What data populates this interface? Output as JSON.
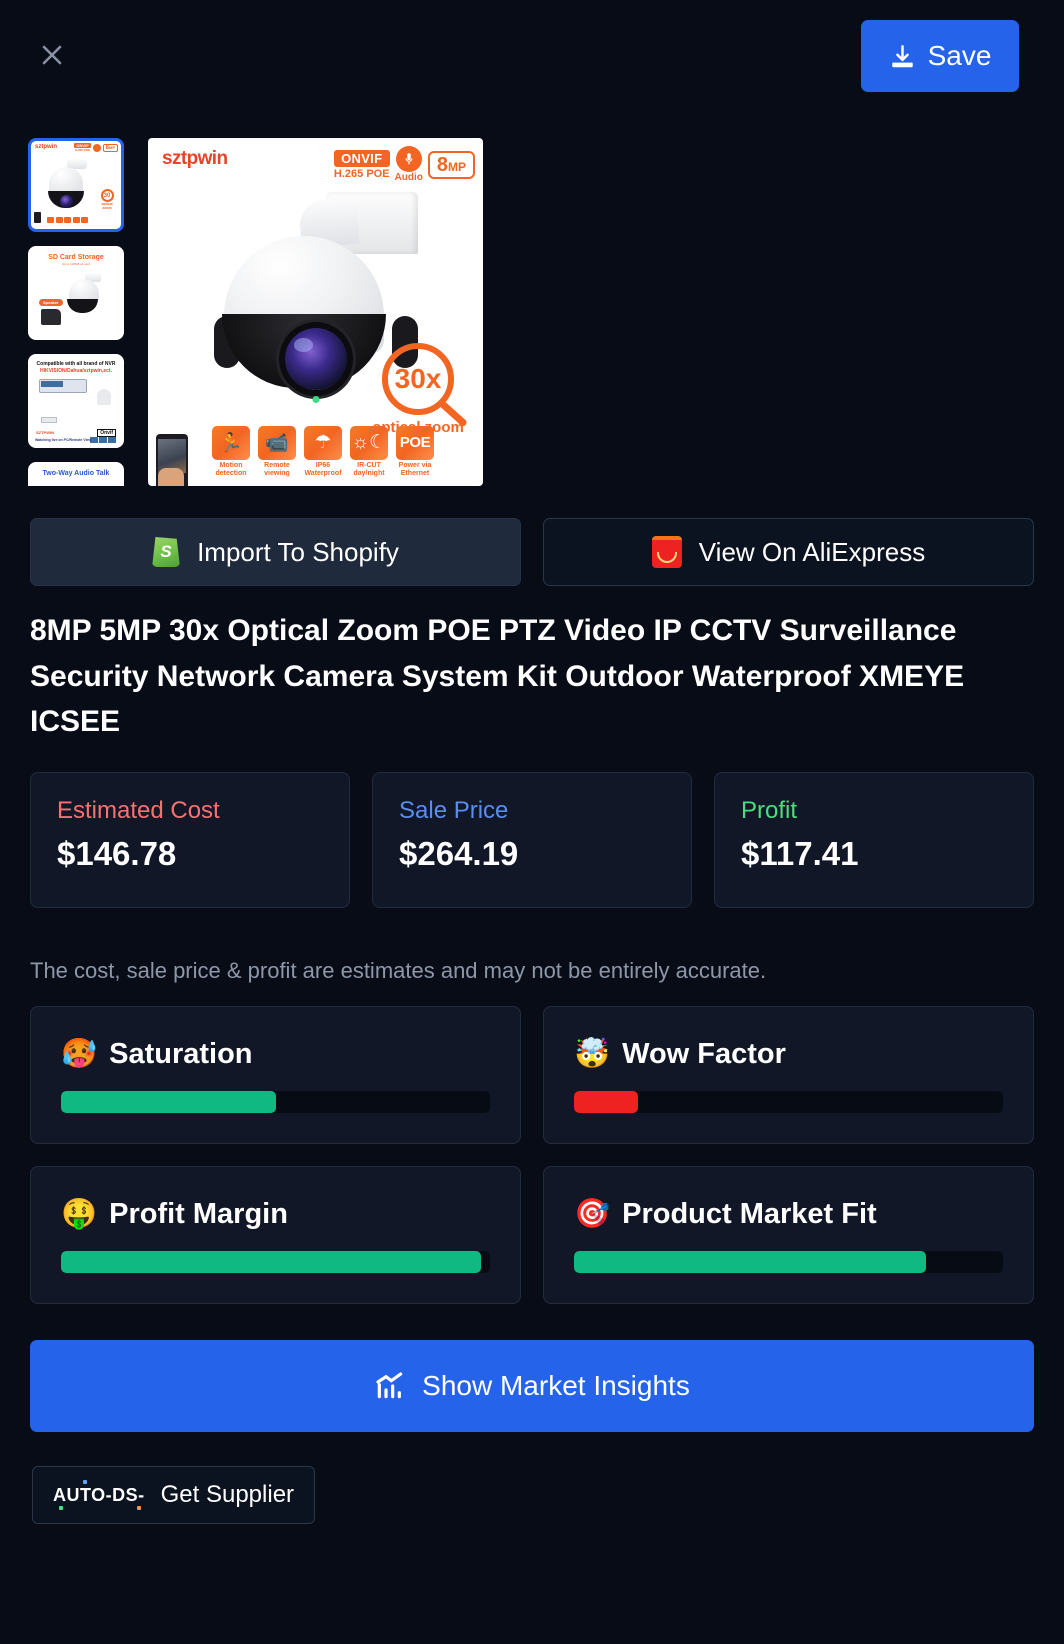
{
  "header": {
    "close_icon": "close-icon",
    "save_label": "Save",
    "save_icon": "download-icon",
    "save_color": "#2563eb"
  },
  "gallery": {
    "thumbnails": [
      {
        "name": "thumbnail-1",
        "caption": "sztpwin 30x optical zoom PTZ camera",
        "selected": true
      },
      {
        "name": "thumbnail-2",
        "caption": "SD Card Storage",
        "selected": false
      },
      {
        "name": "thumbnail-3",
        "caption": "Compatible with all brand of NVR HIKVISION/Dahua/sztpwin,ect.",
        "selected": false
      },
      {
        "name": "thumbnail-4",
        "caption": "Two-Way Audio Talk",
        "selected": false
      }
    ],
    "main_image": {
      "brand": "sztpwin",
      "badges": {
        "onvif_top": "ONVIF",
        "onvif_bottom": "H.265 POE",
        "audio": "Audio",
        "megapixels": "8",
        "megapixels_unit": "MP"
      },
      "zoom_value": "30x",
      "zoom_label": "optical zoom",
      "features": [
        {
          "icon": "motion-detection-icon",
          "glyph": "🏃",
          "label": "Motion detection"
        },
        {
          "icon": "remote-viewing-icon",
          "glyph": "📹",
          "label": "Remote viewing"
        },
        {
          "icon": "waterproof-icon",
          "glyph": "☂",
          "label": "IP66 Waterproof"
        },
        {
          "icon": "ir-cut-icon",
          "glyph": "☼",
          "label": "IR-CUT day/night"
        },
        {
          "icon": "poe-icon",
          "glyph": "POE",
          "label": "Power via Ethernet"
        }
      ]
    }
  },
  "actions": {
    "import_shopify": "Import To Shopify",
    "import_shopify_icon": "shopify-bag-icon",
    "view_aliexpress": "View On AliExpress",
    "view_aliexpress_icon": "aliexpress-bag-icon"
  },
  "product": {
    "title": "8MP 5MP 30x Optical Zoom POE PTZ Video IP CCTV Surveillance Security Network Camera System Kit Outdoor Waterproof XMEYE ICSEE"
  },
  "prices": [
    {
      "label": "Estimated Cost",
      "value": "$146.78",
      "color": "#f87171"
    },
    {
      "label": "Sale Price",
      "value": "$264.19",
      "color": "#5b8def"
    },
    {
      "label": "Profit",
      "value": "$117.41",
      "color": "#4ade80"
    }
  ],
  "disclaimer": "The cost, sale price & profit are estimates and may not be entirely accurate.",
  "metrics": [
    {
      "name": "Saturation",
      "emoji": "🥵",
      "emoji_name": "hot-face-emoji",
      "percent": 50,
      "color": "#10b981"
    },
    {
      "name": "Wow Factor",
      "emoji": "🤯",
      "emoji_name": "exploding-head-emoji",
      "percent": 15,
      "color": "#ef2222"
    },
    {
      "name": "Profit Margin",
      "emoji": "🤑",
      "emoji_name": "money-face-emoji",
      "percent": 98,
      "color": "#10b981"
    },
    {
      "name": "Product Market Fit",
      "emoji": "🎯",
      "emoji_name": "dart-target-emoji",
      "percent": 82,
      "color": "#10b981"
    }
  ],
  "footer": {
    "insights_label": "Show Market Insights",
    "insights_icon": "chart-trend-icon",
    "insights_color": "#2563eb",
    "supplier_label": "Get Supplier",
    "supplier_logo": "AUTO-DS-"
  }
}
